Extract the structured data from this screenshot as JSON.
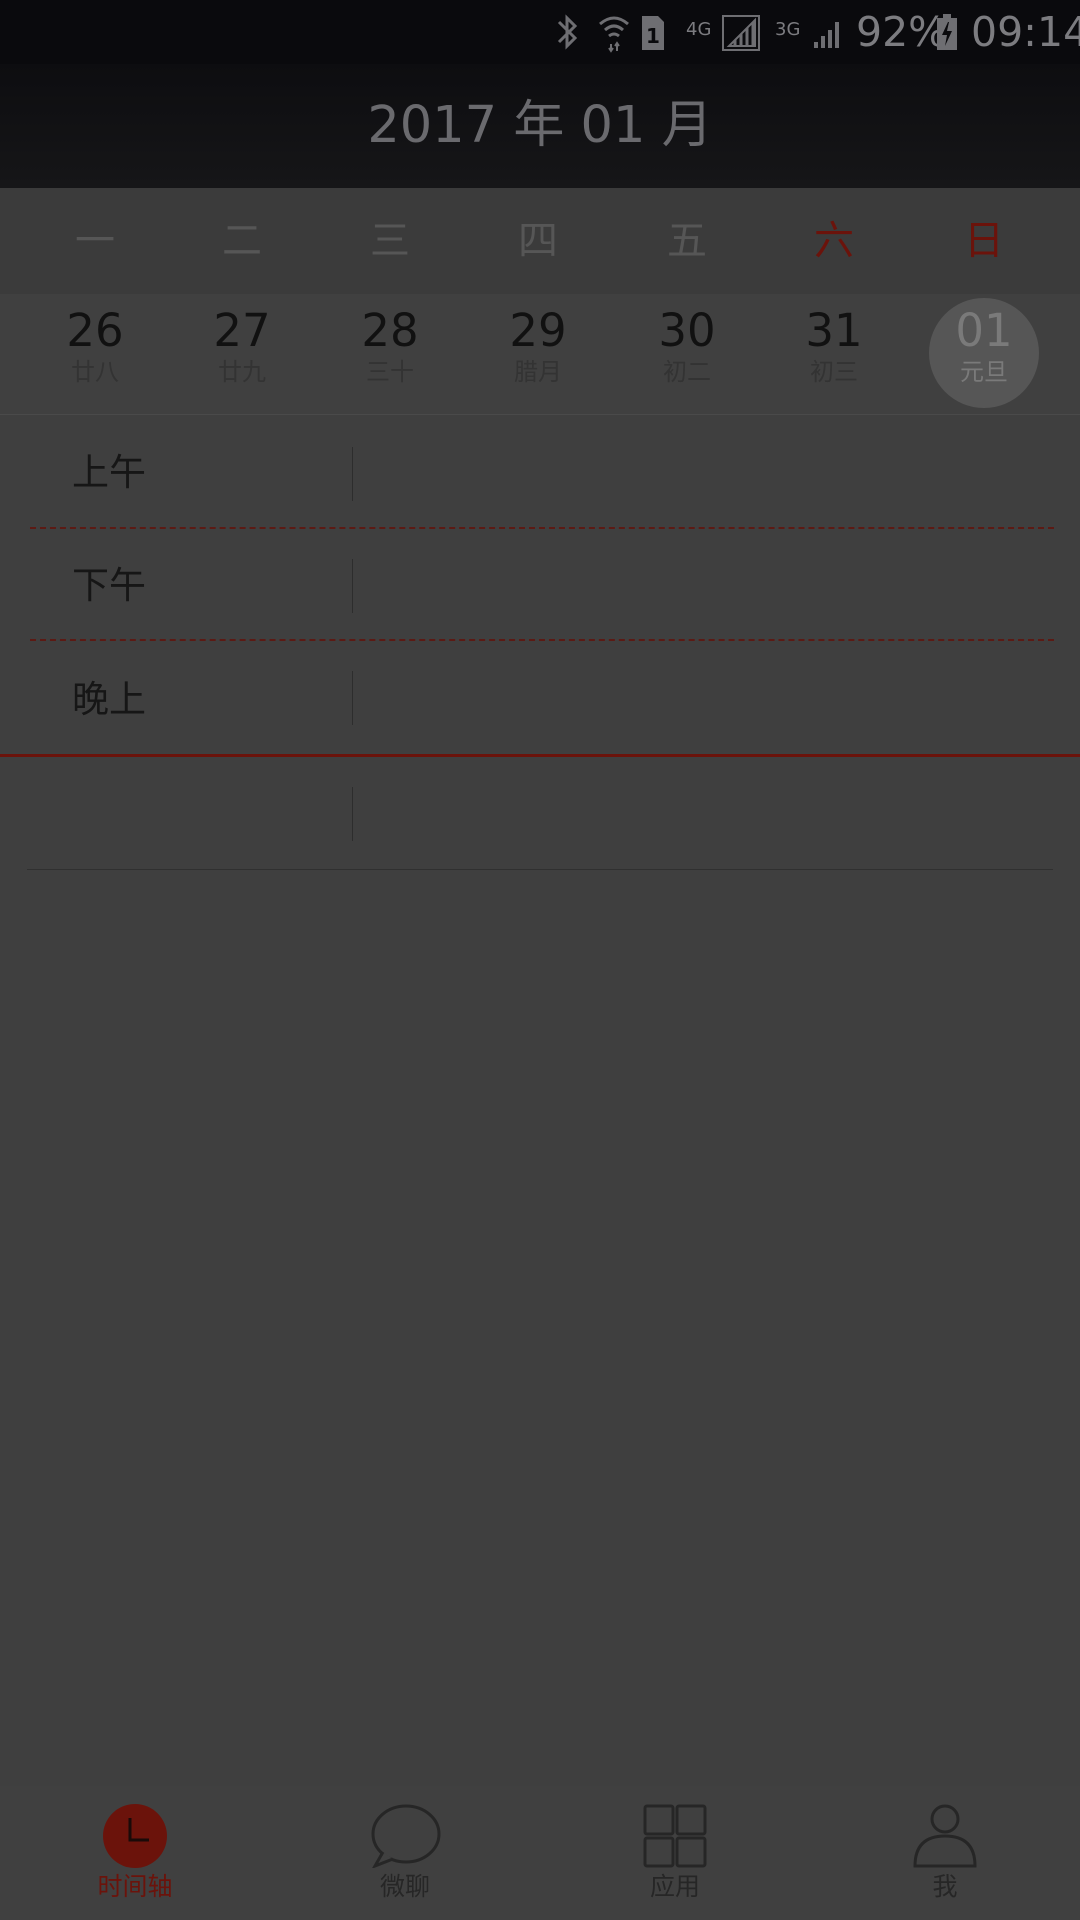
{
  "status_bar": {
    "network_4g": "4G",
    "network_3g": "3G",
    "battery": "92%",
    "time": "09:14",
    "icons": [
      "bluetooth-icon",
      "wifi-icon",
      "sim1-icon",
      "signal-4g-icon",
      "signal-3g-icon",
      "battery-charging-icon"
    ]
  },
  "header": {
    "title": "2017 年 01 月"
  },
  "week": {
    "days": [
      "一",
      "二",
      "三",
      "四",
      "五",
      "六",
      "日"
    ],
    "weekend_color": "#6b130b"
  },
  "dates": [
    {
      "day": "26",
      "lunar": "廿八"
    },
    {
      "day": "27",
      "lunar": "廿九"
    },
    {
      "day": "28",
      "lunar": "三十"
    },
    {
      "day": "29",
      "lunar": "腊月"
    },
    {
      "day": "30",
      "lunar": "初二"
    },
    {
      "day": "31",
      "lunar": "初三"
    },
    {
      "day": "01",
      "lunar": "元旦",
      "selected": true
    }
  ],
  "timeline": {
    "morning": "上午",
    "afternoon": "下午",
    "evening": "晚上"
  },
  "bottom_nav": {
    "items": [
      {
        "label": "时间轴",
        "icon": "clock-icon",
        "active": true
      },
      {
        "label": "微聊",
        "icon": "chat-bubble-icon"
      },
      {
        "label": "应用",
        "icon": "apps-grid-icon"
      },
      {
        "label": "我",
        "icon": "person-icon"
      }
    ]
  },
  "colors": {
    "accent": "#6b130b",
    "overlay_bg": "#3f3f3f"
  }
}
